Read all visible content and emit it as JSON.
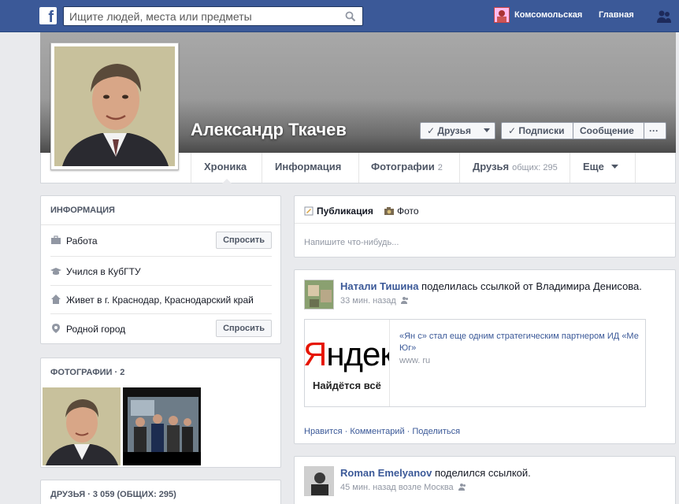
{
  "topbar": {
    "search_placeholder": "Ищите людей, места или предметы",
    "user_link": "Комсомольская",
    "home_link": "Главная"
  },
  "profile": {
    "name": "Александр Ткачев",
    "buttons": {
      "friends": "✓ Друзья",
      "subscriptions": "✓ Подписки",
      "message": "Сообщение",
      "more": "···"
    }
  },
  "profile_nav": {
    "timeline": "Хроника",
    "about": "Информация",
    "photos": "Фотографии",
    "photos_count": "2",
    "friends": "Друзья",
    "friends_sub": "общих: 295",
    "more": "Еще"
  },
  "info_box": {
    "header": "Информация",
    "rows": [
      {
        "label": "Работа",
        "action": "Спросить"
      },
      {
        "label": "Учился в КубГТУ"
      },
      {
        "label": "Живет в г. Краснодар, Краснодарский край"
      },
      {
        "label": "Родной город",
        "action": "Спросить"
      }
    ]
  },
  "photos_box": {
    "header": "Фотографии · 2"
  },
  "friends_box": {
    "header": "Друзья · 3 059 (общих: 295)"
  },
  "composer": {
    "tab_post": "Публикация",
    "tab_photo": "Фото",
    "placeholder": "Напишите что-нибудь..."
  },
  "story1": {
    "author": "Натали Тишина",
    "action": " поделилась ссылкой от Владимира Денисова.",
    "time": "33 мин. назад",
    "link_title": "«Ян     с» стал еще одним стратегическим партнером ИД «Ме      Юг»",
    "link_url": "www.                 ru",
    "thumb_logo": "Яндекс",
    "thumb_tagline": "Найдётся всё",
    "actions": "Нравится · Комментарий · Поделиться"
  },
  "story2": {
    "author": "Roman Emelyanov",
    "action": " поделился ссылкой.",
    "time": "45 мин. назад возле Москва"
  }
}
